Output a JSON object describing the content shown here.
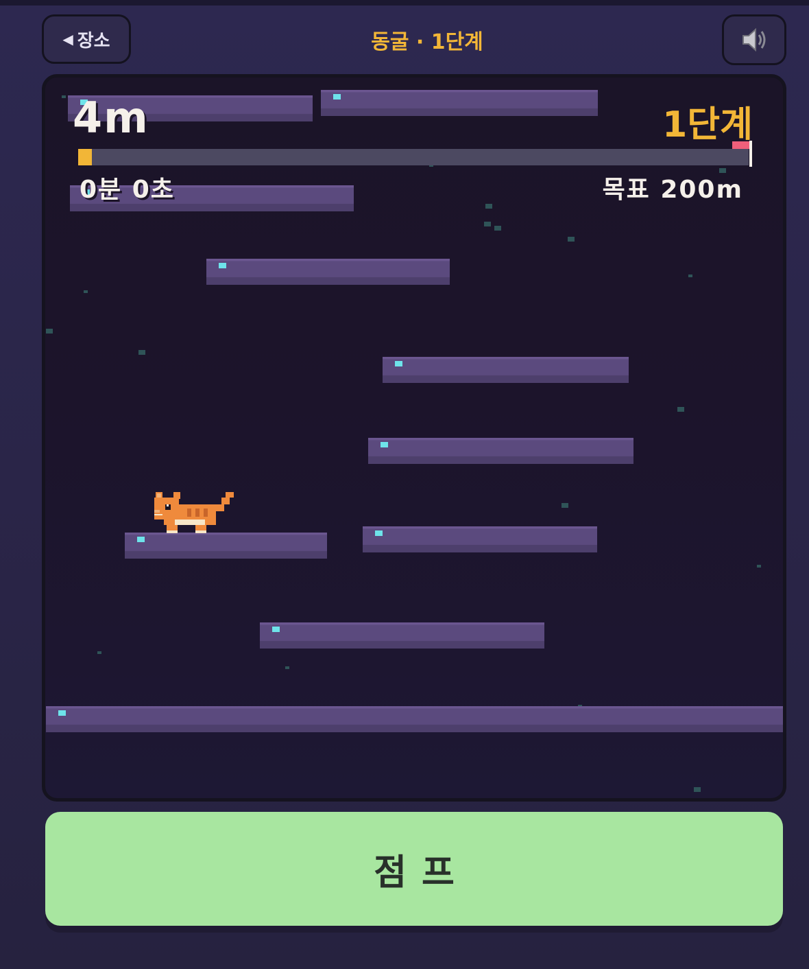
{
  "header": {
    "back_label": "장소",
    "title": "동굴 · 1단계"
  },
  "icons": {
    "back": "back-arrow-icon",
    "sound": "speaker-icon"
  },
  "hud": {
    "distance": "4m",
    "stage": "1단계",
    "timer": "0분 0초",
    "goal": "목표 200m",
    "progress_fraction": 0.02
  },
  "controls": {
    "jump_label": "점프"
  },
  "colors": {
    "accent": "#f2b637",
    "jump_button": "#a8e6a0",
    "platform": "#5b4a7e",
    "gem": "#6ee3ea",
    "goal_flag": "#ef5f7a",
    "cat": "#ef8a3c"
  }
}
